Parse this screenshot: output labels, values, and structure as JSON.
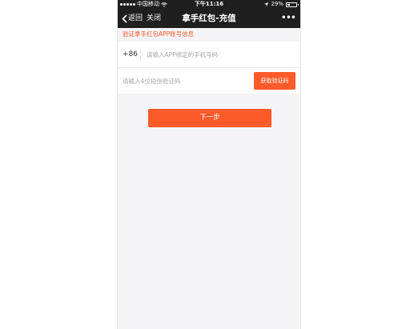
{
  "status_bar": {
    "carrier": "中国移动",
    "time": "下午11:16",
    "battery_text": "29%",
    "battery_level": 0.29
  },
  "nav": {
    "back_label": "返回",
    "close_label": "关闭",
    "title": "拿手红包-充值",
    "more_label": "•••"
  },
  "form": {
    "notice": "验证拿手红包APP账号信息",
    "country_code": "+86",
    "phone_placeholder": "请输入APP绑定的手机号码",
    "phone_value": "",
    "code_placeholder": "请输入4位短信验证码",
    "code_value": "",
    "get_code_label": "获取验证码"
  },
  "actions": {
    "next_label": "下一步"
  },
  "colors": {
    "accent": "#ff5a2a",
    "nav_bg": "#1f1f1f",
    "page_bg": "#f4f4f6"
  }
}
